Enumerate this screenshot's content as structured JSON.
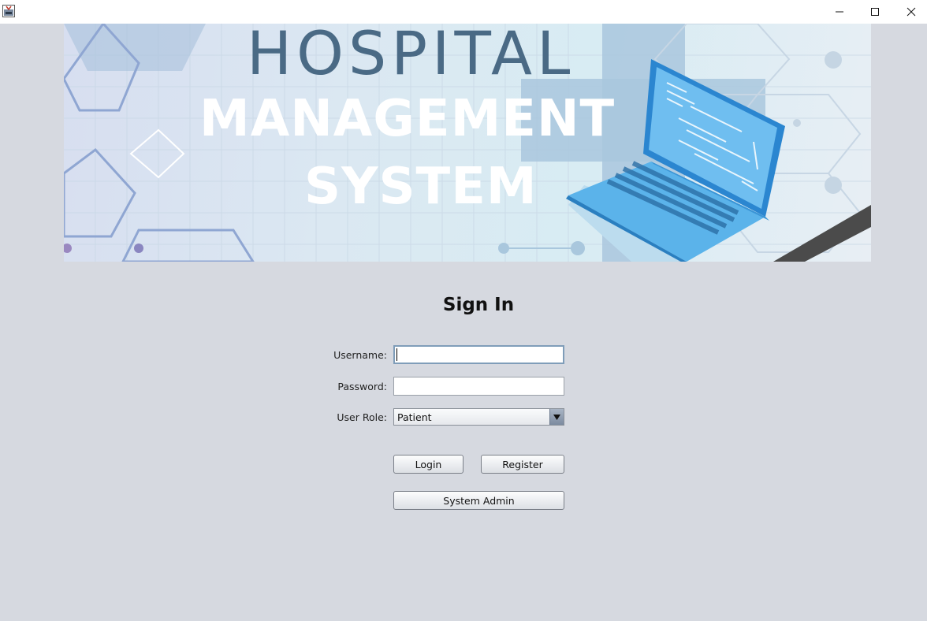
{
  "window": {
    "app_icon": "java-app-icon",
    "controls": [
      "minimize-icon",
      "maximize-icon",
      "close-icon"
    ]
  },
  "banner": {
    "line1": "HOSPITAL",
    "line2": "MANAGEMENT",
    "line3": "SYSTEM"
  },
  "form": {
    "title": "Sign In",
    "username_label": "Username:",
    "username_value": "",
    "password_label": "Password:",
    "password_value": "",
    "role_label": "User Role:",
    "role_selected": "Patient",
    "login_label": "Login",
    "register_label": "Register",
    "admin_label": "System Admin"
  },
  "colors": {
    "background": "#d6d9e0",
    "titlebar": "#ffffff",
    "banner_accent": "#4a6a85"
  }
}
